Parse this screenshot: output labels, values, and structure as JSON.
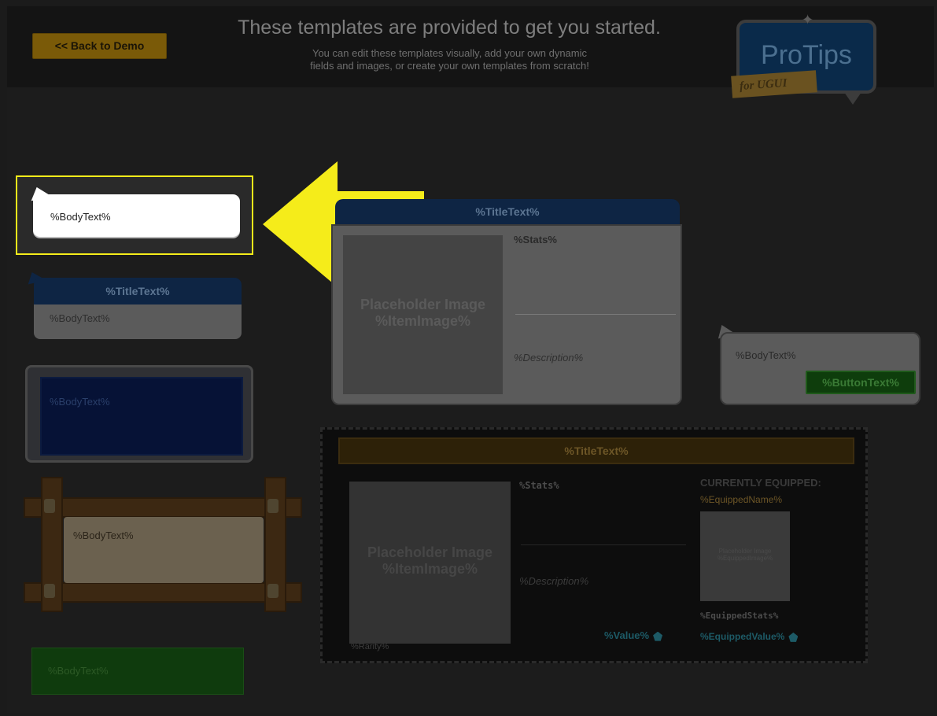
{
  "header": {
    "back_button_label": "<< Back to Demo",
    "title": "These templates are provided to get you started.",
    "subtitle_line1": "You can edit these templates visually, add your own dynamic",
    "subtitle_line2": "fields and images, or create your own templates from scratch!"
  },
  "logo": {
    "name": "ProTips",
    "ribbon": "for UGUI"
  },
  "templates": {
    "simple_bubble": {
      "body": "%BodyText%"
    },
    "title_bubble": {
      "title": "%TitleText%",
      "body": "%BodyText%"
    },
    "scifi_frame": {
      "body": "%BodyText%"
    },
    "wood_frame": {
      "body": "%BodyText%"
    },
    "green_box": {
      "body": "%BodyText%"
    },
    "item_card": {
      "title": "%TitleText%",
      "image_line1": "Placeholder Image",
      "image_line2": "%ItemImage%",
      "stats": "%Stats%",
      "description": "%Description%"
    },
    "button_bubble": {
      "body": "%BodyText%",
      "button": "%ButtonText%"
    },
    "compare_card": {
      "title": "%TitleText%",
      "image_line1": "Placeholder Image",
      "image_line2": "%ItemImage%",
      "stats": "%Stats%",
      "description": "%Description%",
      "value": "%Value%",
      "rarity": "%Rarity%",
      "equipped_heading": "CURRENTLY EQUIPPED:",
      "equipped_name": "%EquippedName%",
      "equipped_image_line1": "Placeholder Image",
      "equipped_image_line2": "%EquippedImage%",
      "equipped_stats": "%EquippedStats%",
      "equipped_value": "%EquippedValue%"
    }
  },
  "colors": {
    "highlight": "#f5ec1a",
    "arrow": "#f5ec1a",
    "back_button": "#7a5a08"
  }
}
